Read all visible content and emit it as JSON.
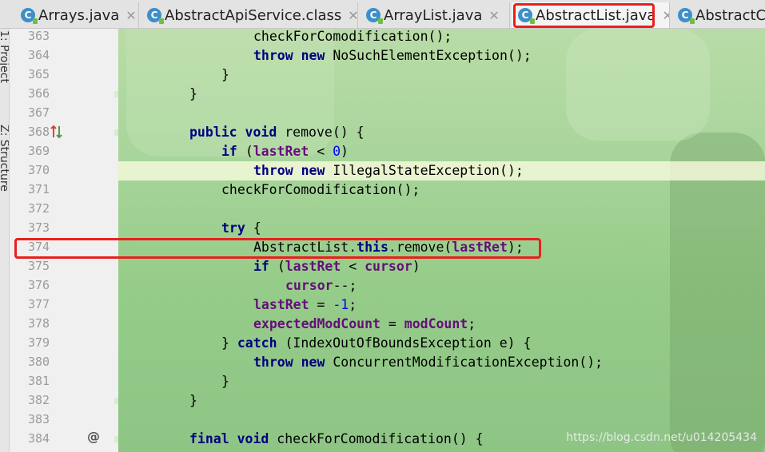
{
  "tabs": [
    {
      "label": "Arrays.java",
      "icon": "class-icon",
      "active": false
    },
    {
      "label": "AbstractApiService.class",
      "icon": "class-icon",
      "active": false
    },
    {
      "label": "ArrayList.java",
      "icon": "class-icon",
      "active": false
    },
    {
      "label": "AbstractList.java",
      "icon": "class-icon",
      "active": true
    },
    {
      "label": "AbstractC",
      "icon": "class-icon",
      "active": false
    }
  ],
  "tool_windows": [
    "1: Project",
    "Z: Structure"
  ],
  "gutter": {
    "line_numbers": [
      "363",
      "364",
      "365",
      "366",
      "367",
      "368",
      "369",
      "370",
      "371",
      "372",
      "373",
      "374",
      "375",
      "376",
      "377",
      "378",
      "379",
      "380",
      "381",
      "382",
      "383",
      "384"
    ],
    "override_marker_line": "368",
    "annotation_marker_line": "384",
    "annotation_marker": "@"
  },
  "editor": {
    "highlighted_line": "374",
    "current_line": "370",
    "code": {
      "l363": "checkForComodification();",
      "l364_kw1": "throw",
      "l364_kw2": "new",
      "l364_rest": "NoSuchElementException();",
      "l365": "}",
      "l366": "}",
      "l368_kw1": "public",
      "l368_kw2": "void",
      "l368_rest": "remove() {",
      "l369_kw": "if",
      "l369_a": "(",
      "l369_field": "lastRet",
      "l369_b": "<",
      "l369_num": "0",
      "l369_c": ")",
      "l370_kw1": "throw",
      "l370_kw2": "new",
      "l370_rest": "IllegalStateException();",
      "l371": "checkForComodification();",
      "l373_kw": "try",
      "l373_rest": "{",
      "l374_a": "AbstractList.",
      "l374_kw": "this",
      "l374_b": ".remove(",
      "l374_field": "lastRet",
      "l374_c": ");",
      "l375_kw": "if",
      "l375_a": "(",
      "l375_f1": "lastRet",
      "l375_b": "<",
      "l375_f2": "cursor",
      "l375_c": ")",
      "l376_field": "cursor",
      "l376_rest": "--;",
      "l377_field": "lastRet",
      "l377_a": "=",
      "l377_num": "-1",
      "l377_b": ";",
      "l378_f1": "expectedModCount",
      "l378_a": "=",
      "l378_f2": "modCount",
      "l378_b": ";",
      "l379_a": "}",
      "l379_kw": "catch",
      "l379_rest": "(IndexOutOfBoundsException e) {",
      "l380_kw1": "throw",
      "l380_kw2": "new",
      "l380_rest": "ConcurrentModificationException();",
      "l381": "}",
      "l382": "}",
      "l384_kw1": "final",
      "l384_kw2": "void",
      "l384_rest": "checkForComodification() {"
    }
  },
  "watermark": "https://blog.csdn.net/u014205434",
  "colors": {
    "highlight_box": "#e8201c",
    "keyword": "#000080",
    "field": "#660e7a",
    "number": "#0000ff"
  }
}
